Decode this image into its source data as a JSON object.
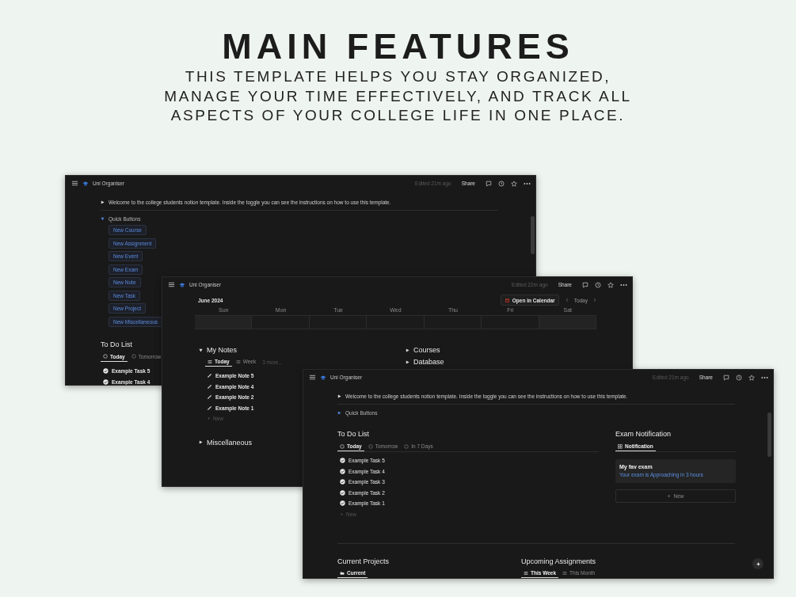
{
  "heading": "MAIN FEATURES",
  "subheading": [
    "THIS TEMPLATE HELPS YOU STAY ORGANIZED,",
    "MANAGE YOUR TIME EFFECTIVELY, AND TRACK ALL",
    "ASPECTS OF YOUR COLLEGE LIFE IN ONE PLACE."
  ],
  "windows": [
    {
      "kind": "buttons_page",
      "breadcrumb": "Uni Organiser",
      "edited": "Edited 21m ago",
      "share": "Share",
      "intro": {
        "text": "Welcome to the college students notion template. Inside the toggle you can see the instructions on how to use this template.",
        "expanded": false
      },
      "quick_buttons": {
        "label": "Quick Buttons",
        "expanded": true,
        "buttons": [
          "New Course",
          "New Assignment",
          "New Event",
          "New Exam",
          "New Note",
          "New Task",
          "New Project",
          "New Miscellaneous"
        ]
      },
      "todo": {
        "title": "To Do List",
        "tabs": [
          {
            "label": "Today",
            "selected": true
          },
          {
            "label": "Tomorrow",
            "selected": false
          }
        ],
        "tasks": [
          {
            "label": "Example Task 5",
            "done": true
          },
          {
            "label": "Example Task 4",
            "done": true
          }
        ]
      }
    },
    {
      "kind": "calendar_page",
      "breadcrumb": "Uni Organiser",
      "edited": "Edited 22m ago",
      "share": "Share",
      "calendar": {
        "month": "June 2024",
        "open_button": "Open in Calendar",
        "today": "Today",
        "weekdays": [
          "Sun",
          "Mon",
          "Tue",
          "Wed",
          "Thu",
          "Fri",
          "Sat"
        ]
      },
      "notes": {
        "title": "My Notes",
        "expanded": true,
        "tabs": [
          {
            "label": "Today",
            "selected": true
          },
          {
            "label": "Week",
            "selected": false
          }
        ],
        "more": "3 more...",
        "items": [
          "Example Note 5",
          "Example Note 4",
          "Example Note 2",
          "Example Note 1"
        ],
        "new": "New"
      },
      "left_sections": [
        {
          "title": "Miscellaneous",
          "expanded": false
        }
      ],
      "right_sections": [
        {
          "title": "Courses",
          "expanded": false
        },
        {
          "title": "Database",
          "expanded": false
        }
      ]
    },
    {
      "kind": "dashboard_page",
      "breadcrumb": "Uni Organiser",
      "edited": "Edited 21m ago",
      "share": "Share",
      "intro": {
        "text": "Welcome to the college students notion template. Inside the toggle you can see the instructions on how to use this template.",
        "expanded": false
      },
      "quick_buttons": {
        "label": "Quick Buttons",
        "expanded": false
      },
      "todo": {
        "title": "To Do List",
        "tabs": [
          {
            "label": "Today",
            "selected": true
          },
          {
            "label": "Tomorrow",
            "selected": false
          },
          {
            "label": "In 7 Days",
            "selected": false
          }
        ],
        "tasks": [
          {
            "label": "Example Task 5",
            "done": true
          },
          {
            "label": "Example Task 4",
            "done": true
          },
          {
            "label": "Example Task 3",
            "done": true
          },
          {
            "label": "Example Task 2",
            "done": true
          },
          {
            "label": "Example Task 1",
            "done": true
          }
        ],
        "new": "New"
      },
      "exam": {
        "title": "Exam Notification",
        "view": "Notification",
        "card": {
          "title": "My fav exam",
          "text": "Your exam is Approaching in 3 hours"
        },
        "new": "New"
      },
      "projects": {
        "title": "Current Projects",
        "tabs": [
          {
            "label": "Current",
            "selected": true
          }
        ]
      },
      "assignments": {
        "title": "Upcoming Assignments",
        "tabs": [
          {
            "label": "This Week",
            "selected": true
          },
          {
            "label": "This Month",
            "selected": false
          }
        ]
      }
    }
  ]
}
